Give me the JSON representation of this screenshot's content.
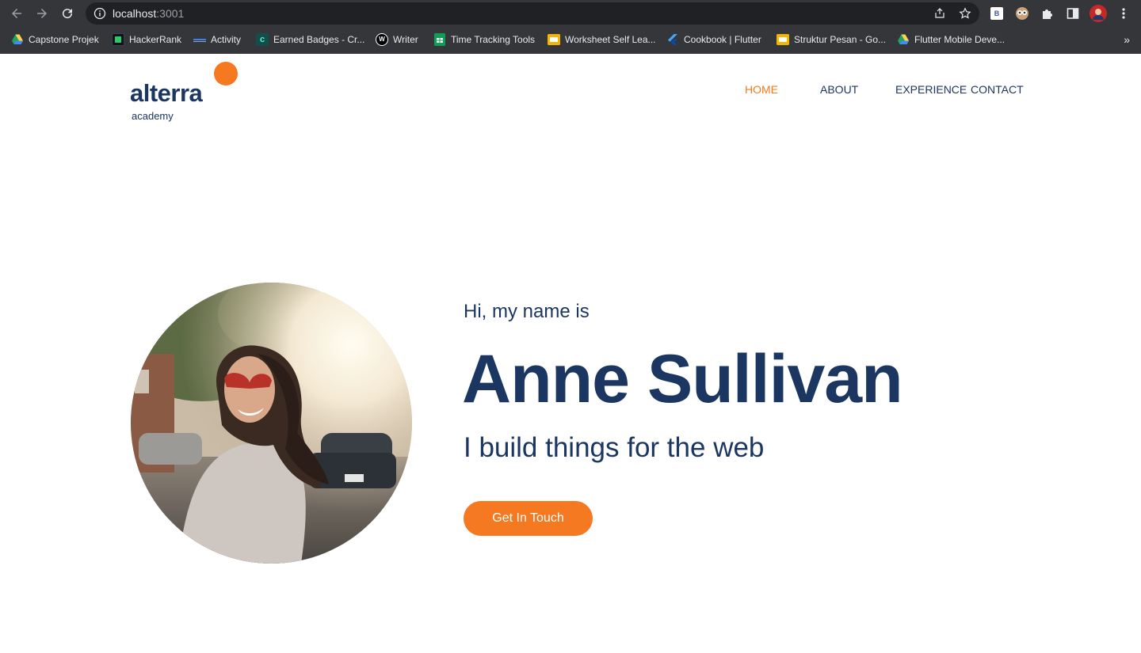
{
  "browser": {
    "url_host": "localhost",
    "url_port": ":3001",
    "bookmarks": [
      {
        "label": "Capstone Projek",
        "icon": "google-drive-icon",
        "color": "#1fa463"
      },
      {
        "label": "HackerRank",
        "icon": "hackerrank-icon",
        "color": "#0e141e"
      },
      {
        "label": "Activity",
        "icon": "activity-icon",
        "color": "#3b82f6"
      },
      {
        "label": "Earned Badges - Cr...",
        "icon": "credly-icon",
        "color": "#0f766e"
      },
      {
        "label": "Writer",
        "icon": "writer-icon",
        "color": "#000000"
      },
      {
        "label": "Time Tracking Tools",
        "icon": "sheets-icon",
        "color": "#0f9d58"
      },
      {
        "label": "Worksheet Self Lea...",
        "icon": "slides-icon",
        "color": "#f4b400"
      },
      {
        "label": "Cookbook | Flutter",
        "icon": "flutter-icon",
        "color": "#42a5f5"
      },
      {
        "label": "Struktur Pesan - Go...",
        "icon": "slides-icon",
        "color": "#f4b400"
      },
      {
        "label": "Flutter Mobile Deve...",
        "icon": "google-drive-icon",
        "color": "#1fa463"
      }
    ],
    "more_label": "»"
  },
  "header": {
    "logo_word": "alterra",
    "logo_sub": "academy",
    "brand_color": "#f47920",
    "nav": [
      {
        "label": "HOME",
        "active": true
      },
      {
        "label": "ABOUT",
        "active": false
      },
      {
        "label": "EXPERIENCE",
        "active": false
      },
      {
        "label": "CONTACT",
        "active": false
      }
    ]
  },
  "hero": {
    "greeting": "Hi, my name is",
    "name": "Anne Sullivan",
    "tagline": "I build things for the web",
    "cta_label": "Get In Touch",
    "text_color": "#1b3660"
  }
}
